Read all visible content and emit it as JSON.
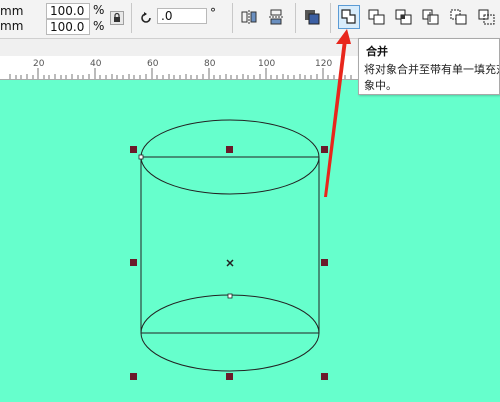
{
  "toolbar": {
    "width_unit": "mm",
    "height_unit": "mm",
    "scale_x": "100.0",
    "scale_y": "100.0",
    "percent_x": "%",
    "percent_y": "%",
    "rotation": ".0",
    "degree_symbol": "°"
  },
  "icons": [
    "lock-icon",
    "rotate-icon",
    "mirror-horizontal-icon",
    "mirror-vertical-icon",
    "to-front-icon",
    "weld-icon",
    "trim-icon",
    "intersect-icon",
    "simplify-icon",
    "front-minus-back-icon",
    "back-minus-front-icon"
  ],
  "ruler": {
    "labels": [
      "20",
      "40",
      "60",
      "80",
      "100",
      "120"
    ]
  },
  "tooltip": {
    "title": "合并",
    "description": "将对象合并至带有单一填充对象中。"
  },
  "colors": {
    "canvas": "#66ffcc",
    "annotation_arrow": "#e8261c",
    "selection_handle": "#6b1a2a",
    "active_button": "#5b9bd5"
  }
}
